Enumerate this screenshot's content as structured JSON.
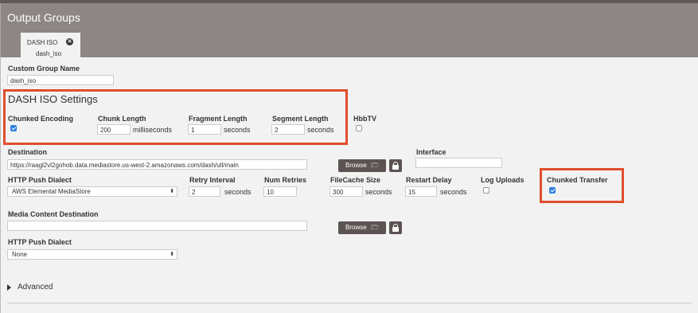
{
  "header": {
    "title": "Output Groups"
  },
  "tab": {
    "name": "DASH ISO",
    "sub": "dash_iso"
  },
  "custom_group_name": {
    "label": "Custom Group Name",
    "value": "dash_iso"
  },
  "dash_settings": {
    "title": "DASH ISO Settings",
    "chunked_encoding": {
      "label": "Chunked Encoding",
      "checked": true
    },
    "chunk_length": {
      "label": "Chunk Length",
      "value": "200",
      "unit": "milliseconds"
    },
    "fragment_length": {
      "label": "Fragment Length",
      "value": "1",
      "unit": "seconds"
    },
    "segment_length": {
      "label": "Segment Length",
      "value": "2",
      "unit": "seconds"
    },
    "hbbtv": {
      "label": "HbbTV",
      "checked": false
    }
  },
  "destination": {
    "label": "Destination",
    "value": "https://raagl2vl2gohob.data.mediastore.us-west-2.amazonaws.com/dash/ull/main",
    "browse_label": "Browse"
  },
  "interface": {
    "label": "Interface",
    "value": ""
  },
  "http_push": {
    "dialect_label": "HTTP Push Dialect",
    "dialect_value": "AWS Elemental MediaStore",
    "retry_interval": {
      "label": "Retry Interval",
      "value": "2",
      "unit": "seconds"
    },
    "num_retries": {
      "label": "Num Retries",
      "value": "10"
    },
    "filecache_size": {
      "label": "FileCache Size",
      "value": "300",
      "unit": "seconds"
    },
    "restart_delay": {
      "label": "Restart Delay",
      "value": "15",
      "unit": "seconds"
    },
    "log_uploads": {
      "label": "Log Uploads",
      "checked": false
    },
    "chunked_transfer": {
      "label": "Chunked Transfer",
      "checked": true
    }
  },
  "media_content_destination": {
    "label": "Media Content Destination",
    "value": "",
    "browse_label": "Browse"
  },
  "http_push_2": {
    "dialect_label": "HTTP Push Dialect",
    "dialect_value": "None"
  },
  "advanced": {
    "label": "Advanced"
  },
  "colors": {
    "header": "#8d8685",
    "highlight": "#e04e2d",
    "button": "#5b5452",
    "checkbox": "#2f7fe0"
  },
  "icons": [
    "close-icon",
    "folder-icon",
    "lock-icon",
    "chevron-down-icon",
    "triangle-right-icon"
  ]
}
